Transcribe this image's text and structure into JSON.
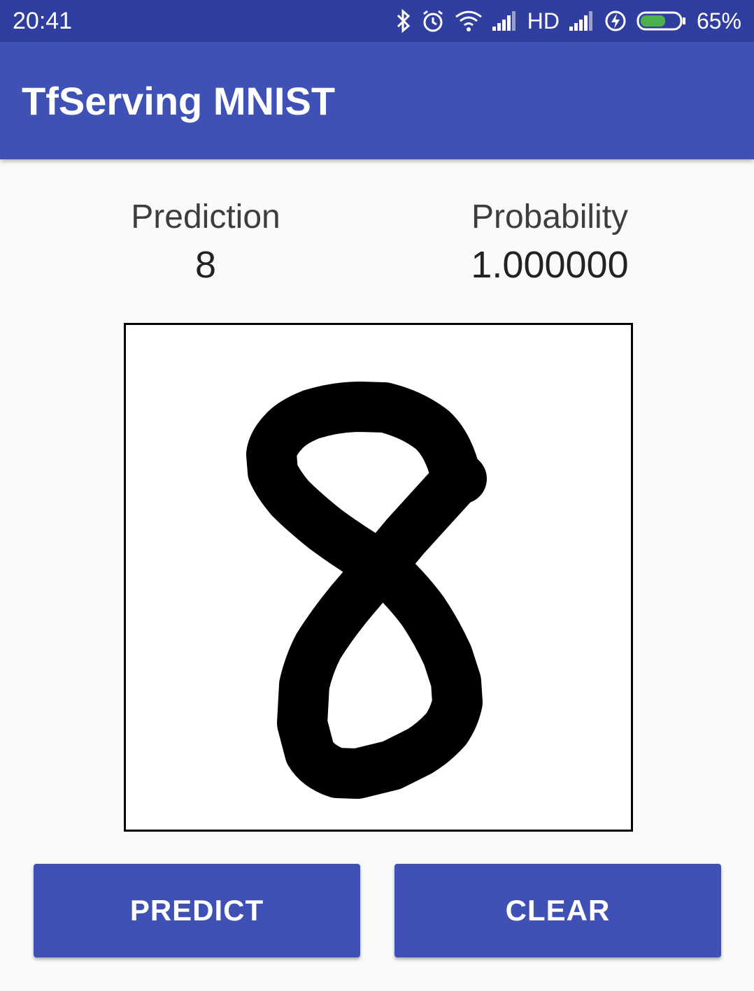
{
  "status_bar": {
    "time": "20:41",
    "network_label": "HD",
    "battery_percent": "65%",
    "battery_level": 0.65,
    "icons": [
      "bluetooth-icon",
      "alarm-icon",
      "wifi-icon",
      "signal-icon",
      "signal-icon",
      "charging-icon",
      "battery-icon"
    ]
  },
  "app_bar": {
    "title": "TfServing MNIST"
  },
  "results": {
    "prediction_label": "Prediction",
    "prediction_value": "8",
    "probability_label": "Probability",
    "probability_value": "1.000000"
  },
  "drawing": {
    "stroke_color": "#000000",
    "background_color": "#ffffff"
  },
  "buttons": {
    "predict_label": "PREDICT",
    "clear_label": "CLEAR"
  },
  "colors": {
    "primary": "#3f51b5",
    "primary_dark": "#303f9f",
    "battery_fill": "#4caf50"
  }
}
